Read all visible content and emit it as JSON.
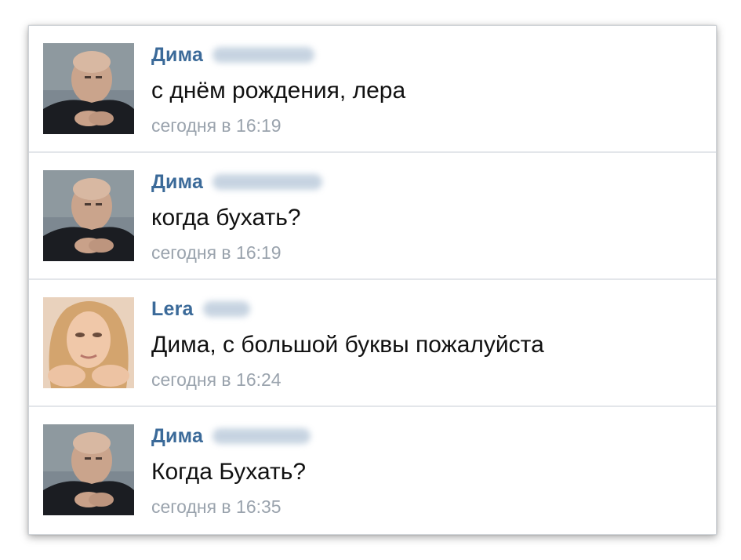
{
  "messages": [
    {
      "author": "Дима",
      "text": "с днём рождения, лера",
      "time": "сегодня в 16:19",
      "avatar": "dima"
    },
    {
      "author": "Дима",
      "text": "когда бухать?",
      "time": "сегодня в 16:19",
      "avatar": "dima"
    },
    {
      "author": "Lera",
      "text": "Дима, с большой буквы пожалуйста",
      "time": "сегодня в 16:24",
      "avatar": "lera"
    },
    {
      "author": "Дима",
      "text": "Когда Бухать?",
      "time": "сегодня в 16:35",
      "avatar": "dima"
    }
  ],
  "colors": {
    "author": "#3b6a99",
    "text": "#111111",
    "time": "#9aa3ad",
    "divider": "#e3e6ea"
  }
}
